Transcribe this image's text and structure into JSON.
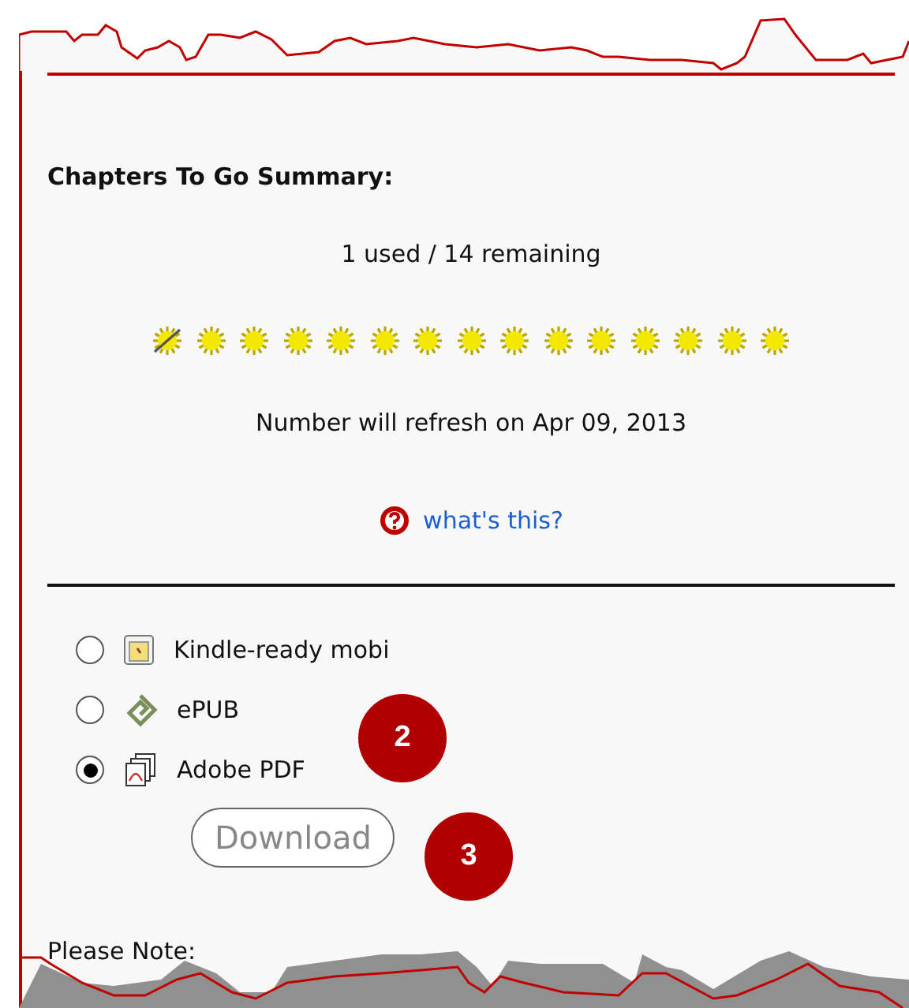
{
  "summary": {
    "title": "Chapters To Go Summary:",
    "usage": "1 used / 14 remaining",
    "tokens": [
      {
        "used": true
      },
      {
        "used": false
      },
      {
        "used": false
      },
      {
        "used": false
      },
      {
        "used": false
      },
      {
        "used": false
      },
      {
        "used": false
      },
      {
        "used": false
      },
      {
        "used": false
      },
      {
        "used": false
      },
      {
        "used": false
      },
      {
        "used": false
      },
      {
        "used": false
      },
      {
        "used": false
      },
      {
        "used": false
      }
    ],
    "refresh": "Number will refresh on Apr 09, 2013",
    "help_link": "what's this?"
  },
  "formats": [
    {
      "label": "Kindle-ready mobi",
      "kind": "kindle",
      "selected": false
    },
    {
      "label": "ePUB",
      "kind": "epub",
      "selected": false
    },
    {
      "label": "Adobe PDF",
      "kind": "pdf",
      "selected": true
    }
  ],
  "download_button": "Download",
  "note": "Please Note:",
  "callouts": [
    "2",
    "3"
  ]
}
